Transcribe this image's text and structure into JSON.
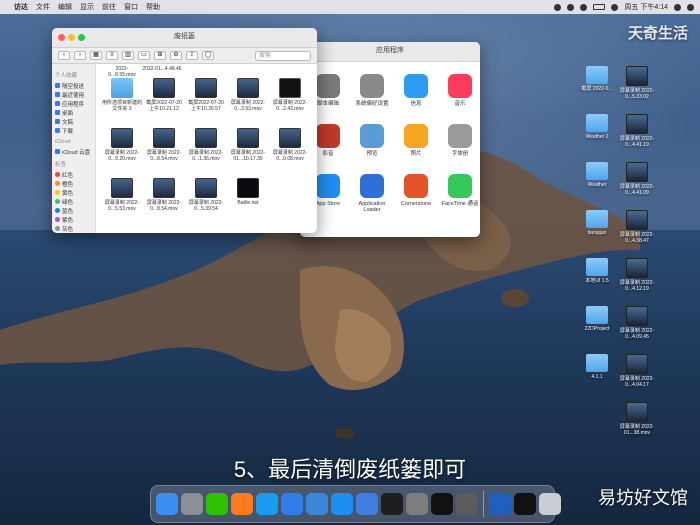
{
  "menubar": {
    "apple": "",
    "items": [
      "访达",
      "文件",
      "编辑",
      "显示",
      "前往",
      "窗口",
      "帮助"
    ],
    "clock": "周五 下午4:14"
  },
  "finder": {
    "title": "废纸篓",
    "search_placeholder": "搜索",
    "sidebar": {
      "favorites_header": "个人收藏",
      "favorites": [
        "隔空投送",
        "最近使用",
        "应用程序",
        "桌面",
        "文稿",
        "下载"
      ],
      "icloud_header": "iCloud",
      "icloud": [
        "iCloud 云盘"
      ],
      "tags_header": "标签",
      "tags": [
        {
          "label": "红色",
          "color": "#ff3b30"
        },
        {
          "label": "橙色",
          "color": "#ff9500"
        },
        {
          "label": "黄色",
          "color": "#ffcc00"
        },
        {
          "label": "绿色",
          "color": "#34c759"
        },
        {
          "label": "蓝色",
          "color": "#0a84ff"
        },
        {
          "label": "紫色",
          "color": "#af52de"
        },
        {
          "label": "灰色",
          "color": "#8e8e93"
        }
      ]
    },
    "top_row": [
      "2022-0...8.55.mov",
      "2022-01...4.48.46"
    ],
    "files": [
      {
        "label": "用所选项目新建的文件夹 3",
        "kind": "folder"
      },
      {
        "label": "截屏2022-07-20 上午10.21.12",
        "kind": "shot"
      },
      {
        "label": "截屏2022-07-20 上午10.26.57",
        "kind": "shot"
      },
      {
        "label": "屏幕录制 2022-0...3.53.mov",
        "kind": "shot"
      },
      {
        "label": "屏幕录制 2022-0...2.43.mov",
        "kind": "dark"
      },
      {
        "label": "屏幕录制 2022-0...9.20.mov",
        "kind": "shot"
      },
      {
        "label": "屏幕录制 2022-0...8.54.mov",
        "kind": "shot"
      },
      {
        "label": "屏幕录制 2022-0...1.36.mov",
        "kind": "shot"
      },
      {
        "label": "屏幕录制 2022-01...10.17.39",
        "kind": "shot"
      },
      {
        "label": "屏幕录制 2022-0...0.08.mov",
        "kind": "shot"
      },
      {
        "label": "屏幕录制 2022-0...5.53.mov",
        "kind": "shot"
      },
      {
        "label": "屏幕录制 2022-0...8.54.mov",
        "kind": "shot"
      },
      {
        "label": "屏幕录制 2022-0...5.39.54",
        "kind": "shot"
      },
      {
        "label": "Battle.net",
        "kind": "battle"
      }
    ]
  },
  "apps_window": {
    "title": "应用程序",
    "apps": [
      {
        "label": "脚本编辑",
        "color": "#7a7a7a"
      },
      {
        "label": "系统偏好设置",
        "color": "#8a8a8a"
      },
      {
        "label": "信息",
        "color": "#2b9bf4"
      },
      {
        "label": "音乐",
        "color": "#fc3c5c"
      },
      {
        "label": "影音",
        "color": "#c0392b"
      },
      {
        "label": "预览",
        "color": "#5a9bd5"
      },
      {
        "label": "照片",
        "color": "#f5a623"
      },
      {
        "label": "字体册",
        "color": "#9b9b9b"
      },
      {
        "label": "App Store",
        "color": "#1f8ef1"
      },
      {
        "label": "Application Loader",
        "color": "#2f6fd6"
      },
      {
        "label": "Cornerstone",
        "color": "#e2542a"
      },
      {
        "label": "FaceTime 通话",
        "color": "#34c759"
      }
    ]
  },
  "desktop_icons": [
    {
      "label": "截屏 2022-0...",
      "kind": "folder"
    },
    {
      "label": "屏幕录制 2022-0...5.33.02",
      "kind": "thumb"
    },
    {
      "label": "Weather 2",
      "kind": "folder"
    },
    {
      "label": "屏幕录制 2022-0...4.41.19",
      "kind": "thumb"
    },
    {
      "label": "Weather",
      "kind": "folder"
    },
    {
      "label": "屏幕录制 2022-0...4.41.09",
      "kind": "thumb"
    },
    {
      "label": "tianqijun",
      "kind": "folder"
    },
    {
      "label": "屏幕录制 2022-0...4.38.47",
      "kind": "thumb"
    },
    {
      "label": "本地UI 1.5",
      "kind": "folder"
    },
    {
      "label": "屏幕录制 2022-0...4.12.19",
      "kind": "thumb"
    },
    {
      "label": "22DProject",
      "kind": "folder"
    },
    {
      "label": "屏幕录制 2022-0...4.09.45",
      "kind": "thumb"
    },
    {
      "label": "4.1.1",
      "kind": "folder"
    },
    {
      "label": "屏幕录制 2022-0...4.04.17",
      "kind": "thumb"
    },
    {
      "label": "",
      "kind": "none"
    },
    {
      "label": "屏幕录制 2022-01...38.mov",
      "kind": "thumb"
    }
  ],
  "dock_icons": [
    {
      "name": "finder-icon",
      "color": "#3b8ff0"
    },
    {
      "name": "launchpad-icon",
      "color": "#8a8f99"
    },
    {
      "name": "wechat-icon",
      "color": "#2dc100"
    },
    {
      "name": "firefox-icon",
      "color": "#ff7a1a"
    },
    {
      "name": "safari-icon",
      "color": "#1a9bf0"
    },
    {
      "name": "xcode-icon",
      "color": "#2e7de9"
    },
    {
      "name": "xcode-instruments-icon",
      "color": "#3a86d9"
    },
    {
      "name": "app-store-icon",
      "color": "#1f8ef1"
    },
    {
      "name": "transfer-icon",
      "color": "#3e7fe0"
    },
    {
      "name": "terminal-icon",
      "color": "#1e1e1e"
    },
    {
      "name": "system-prefs-icon",
      "color": "#7d7d7d"
    },
    {
      "name": "qq-icon",
      "color": "#111111"
    },
    {
      "name": "automator-icon",
      "color": "#5b5b5b"
    },
    {
      "name": "quicktime-icon",
      "color": "#1f5fbf"
    },
    {
      "name": "qq-2-icon",
      "color": "#111111"
    },
    {
      "name": "trash-icon",
      "color": "#c9ced6"
    }
  ],
  "caption": "5、最后清倒废纸篓即可",
  "watermark_top": "天奇生活",
  "watermark_bottom": "易坊好文馆"
}
